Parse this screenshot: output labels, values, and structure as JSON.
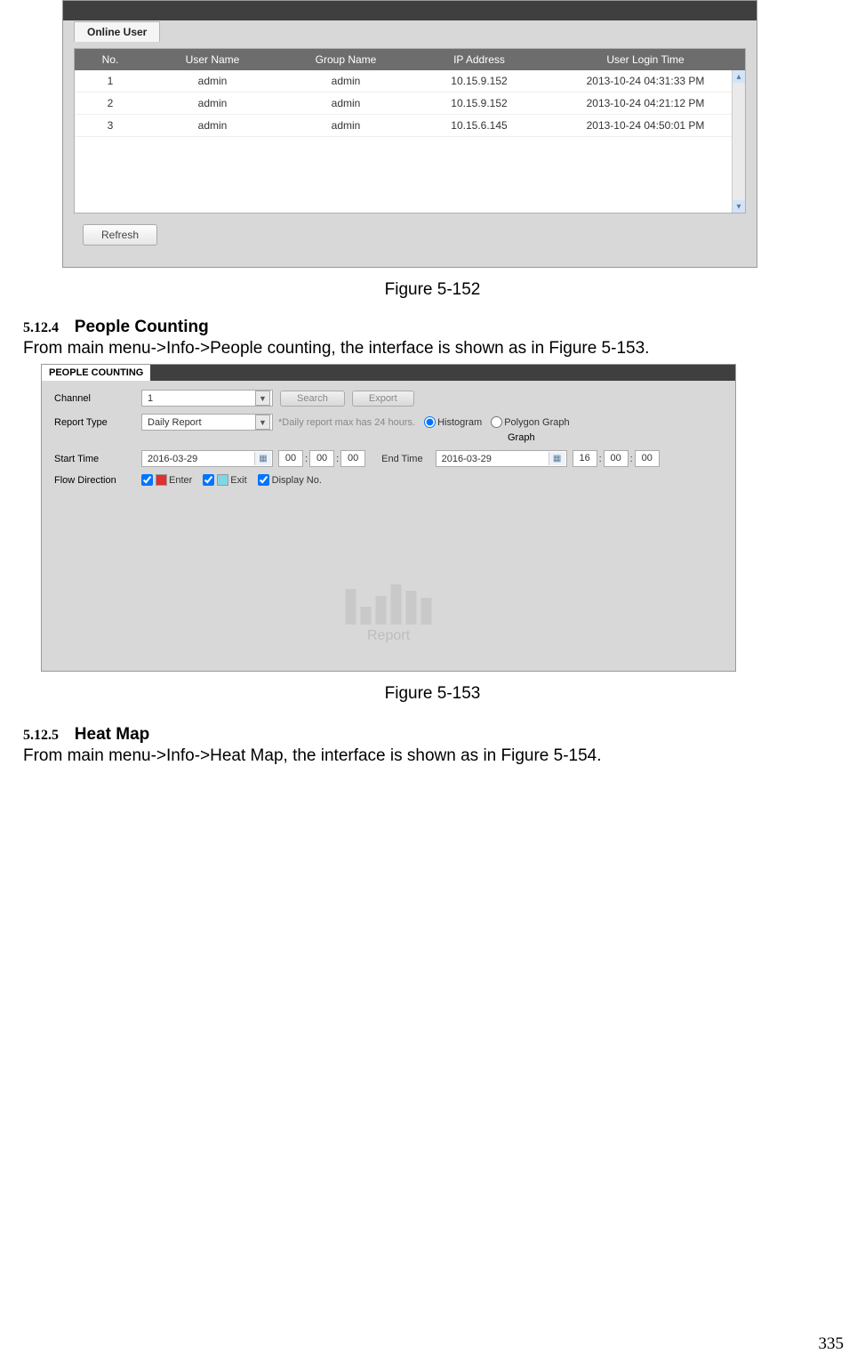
{
  "fig152": {
    "tab": "Online User",
    "headers": {
      "no": "No.",
      "un": "User Name",
      "gn": "Group Name",
      "ip": "IP Address",
      "lt": "User Login Time"
    },
    "rows": [
      {
        "no": "1",
        "un": "admin",
        "gn": "admin",
        "ip": "10.15.9.152",
        "lt": "2013-10-24 04:31:33 PM"
      },
      {
        "no": "2",
        "un": "admin",
        "gn": "admin",
        "ip": "10.15.9.152",
        "lt": "2013-10-24 04:21:12 PM"
      },
      {
        "no": "3",
        "un": "admin",
        "gn": "admin",
        "ip": "10.15.6.145",
        "lt": "2013-10-24 04:50:01 PM"
      }
    ],
    "refresh": "Refresh",
    "caption": "Figure 5-152"
  },
  "sec124": {
    "num": "5.12.4",
    "title": "People Counting",
    "body": "From main menu->Info->People counting, the interface is shown as in Figure 5-153."
  },
  "fig153": {
    "tab": "PEOPLE COUNTING",
    "labels": {
      "channel": "Channel",
      "report": "Report Type",
      "start": "Start Time",
      "end": "End Time",
      "flow": "Flow Direction",
      "enter": "Enter",
      "exit": "Exit",
      "display": "Display No.",
      "search": "Search",
      "export": "Export",
      "note": "*Daily report max has 24 hours.",
      "histo": "Histogram",
      "poly": "Polygon Graph",
      "graph": "Graph",
      "report_ph": "Report"
    },
    "vals": {
      "channel": "1",
      "report": "Daily Report",
      "startDate": "2016-03-29",
      "sh": "00",
      "sm": "00",
      "ss": "00",
      "endDate": "2016-03-29",
      "eh": "16",
      "em": "00",
      "es": "00"
    },
    "caption": "Figure 5-153"
  },
  "sec125": {
    "num": "5.12.5",
    "title": "Heat Map",
    "body": "From main menu->Info->Heat Map, the interface is shown as in Figure 5-154."
  },
  "pageNum": "335"
}
